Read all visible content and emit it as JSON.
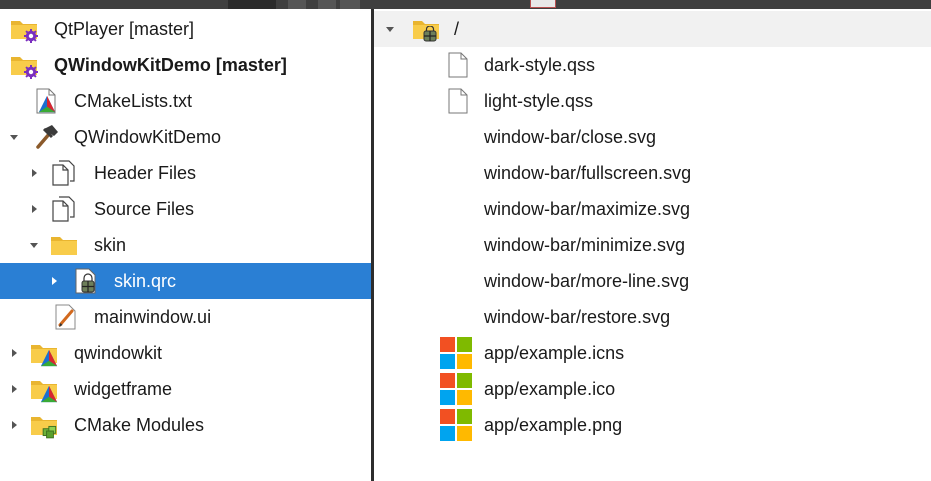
{
  "project_tree": {
    "items": [
      {
        "label": "QtPlayer [master]",
        "bold": false
      },
      {
        "label": "QWindowKitDemo [master]",
        "bold": true
      },
      {
        "label": "CMakeLists.txt"
      },
      {
        "label": "QWindowKitDemo"
      },
      {
        "label": "Header Files"
      },
      {
        "label": "Source Files"
      },
      {
        "label": "skin"
      },
      {
        "label": "skin.qrc"
      },
      {
        "label": "mainwindow.ui"
      },
      {
        "label": "qwindowkit"
      },
      {
        "label": "widgetframe"
      },
      {
        "label": "CMake Modules"
      }
    ]
  },
  "resource_view": {
    "root": {
      "label": "/"
    },
    "files": [
      {
        "label": "dark-style.qss"
      },
      {
        "label": "light-style.qss"
      },
      {
        "label": "window-bar/close.svg"
      },
      {
        "label": "window-bar/fullscreen.svg"
      },
      {
        "label": "window-bar/maximize.svg"
      },
      {
        "label": "window-bar/minimize.svg"
      },
      {
        "label": "window-bar/more-line.svg"
      },
      {
        "label": "window-bar/restore.svg"
      },
      {
        "label": "app/example.icns"
      },
      {
        "label": "app/example.ico"
      },
      {
        "label": "app/example.png"
      }
    ]
  },
  "colors": {
    "selection": "#2a7fd4",
    "folder": "#f5c342",
    "gear": "#7b2fbf",
    "splitter": "#2d2d2d"
  }
}
